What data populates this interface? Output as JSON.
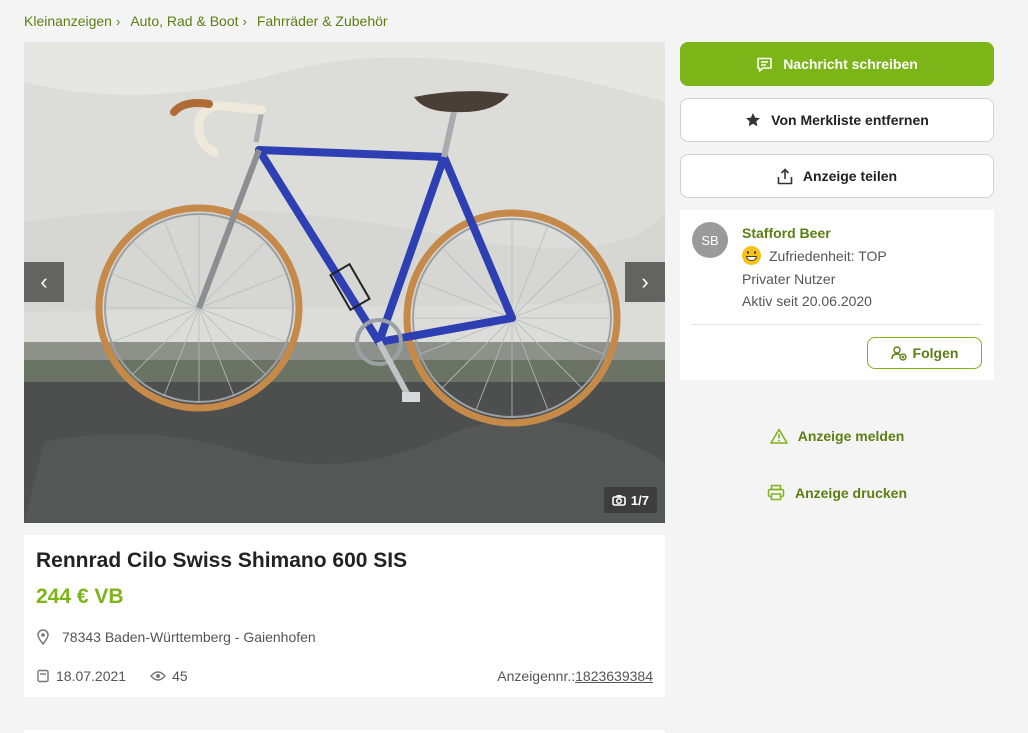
{
  "breadcrumb": [
    "Kleinanzeigen",
    "Auto, Rad & Boot",
    "Fahrräder & Zubehör"
  ],
  "gallery": {
    "counter": "1/7"
  },
  "listing": {
    "title": "Rennrad Cilo Swiss Shimano 600 SIS",
    "price": "244 € VB",
    "location": "78343 Baden-Württemberg - Gaienhofen",
    "date": "18.07.2021",
    "views": "45",
    "ad_number_label": "Anzeigennr.:",
    "ad_number": "1823639384"
  },
  "actions": {
    "message": "Nachricht schreiben",
    "favorite": "Von Merkliste entfernen",
    "share": "Anzeige teilen",
    "report": "Anzeige melden",
    "print": "Anzeige drucken"
  },
  "seller": {
    "initials": "SB",
    "name": "Stafford Beer",
    "rating": "Zufriedenheit: TOP",
    "type": "Privater Nutzer",
    "active_since": "Aktiv seit 20.06.2020",
    "follow": "Folgen"
  },
  "colors": {
    "accent": "#7cb518",
    "link": "#5b7f12",
    "background": "#f4f4f4"
  },
  "icons": [
    "chevron-right-icon",
    "chevron-left-icon",
    "camera-icon",
    "message-icon",
    "star-icon",
    "share-icon",
    "pin-icon",
    "calendar-icon",
    "eye-icon",
    "warning-icon",
    "print-icon",
    "follow-user-icon"
  ]
}
